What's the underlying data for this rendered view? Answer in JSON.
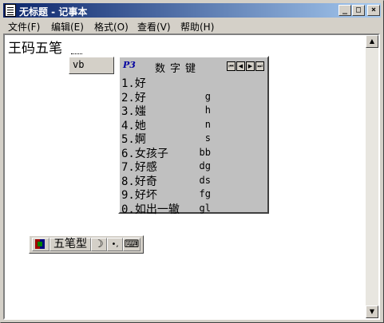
{
  "window": {
    "title": "无标题 - 记事本",
    "buttons": {
      "minimize": "_",
      "maximize": "□",
      "close": "×"
    }
  },
  "menu": [
    {
      "label": "文件(F)"
    },
    {
      "label": "编辑(E)"
    },
    {
      "label": "格式(O)"
    },
    {
      "label": "查看(V)"
    },
    {
      "label": "帮助(H)"
    }
  ],
  "editor": {
    "text": "王码五笔"
  },
  "ime": {
    "composition": "vb",
    "candidate_title": "数字键",
    "candidate_logo": "P3",
    "nav": [
      "⏮",
      "◀",
      "▶",
      "⏭"
    ],
    "candidates": [
      {
        "word": "1.好",
        "code": ""
      },
      {
        "word": "2.好",
        "code": "g"
      },
      {
        "word": "3.媸",
        "code": "h"
      },
      {
        "word": "4.她",
        "code": "n"
      },
      {
        "word": "5.婀",
        "code": "s"
      },
      {
        "word": "6.女孩子",
        "code": "bb"
      },
      {
        "word": "7.好感",
        "code": "dg"
      },
      {
        "word": "8.好奇",
        "code": "ds"
      },
      {
        "word": "9.好坏",
        "code": "fg"
      },
      {
        "word": "0.如出一辙",
        "code": "gl"
      }
    ],
    "status": {
      "mode": "五笔型",
      "moon": "☽",
      "punct": "•,",
      "keyboard": "⌨"
    }
  },
  "scrollbar": {
    "up": "▲",
    "down": "▼"
  },
  "colors": {
    "titlebar_start": "#0a246a",
    "titlebar_end": "#a6caf0",
    "face": "#d4d0c8"
  }
}
